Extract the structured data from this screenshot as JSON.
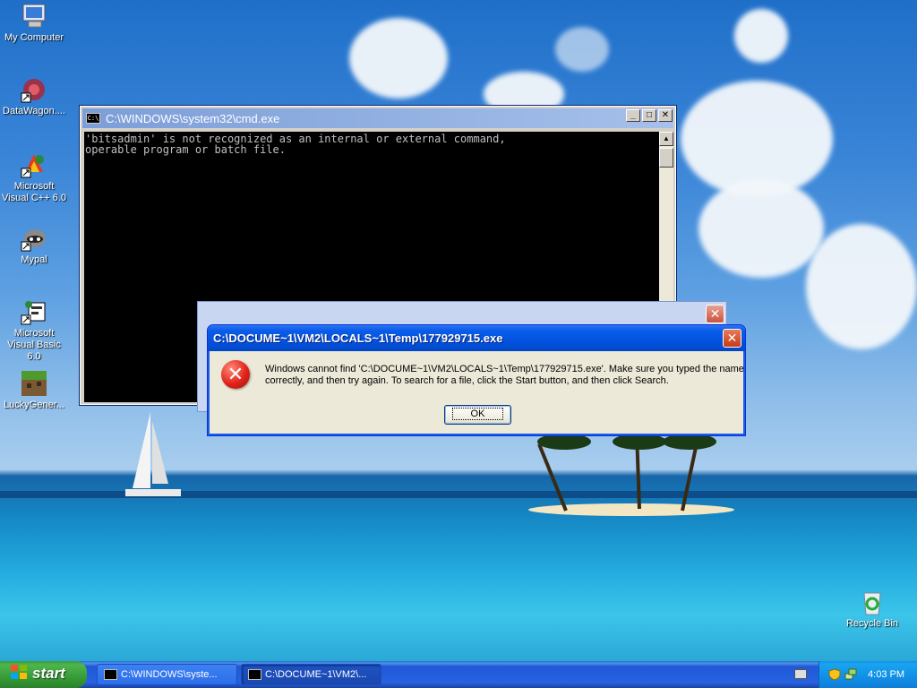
{
  "desktop": {
    "icons": [
      {
        "label": "My Computer"
      },
      {
        "label": "DataWagon...."
      },
      {
        "label": "Microsoft Visual C++ 6.0"
      },
      {
        "label": "Mypal"
      },
      {
        "label": "Microsoft Visual Basic 6.0"
      },
      {
        "label": "LuckyGener..."
      },
      {
        "label": "Recycle Bin"
      }
    ]
  },
  "cmd_window": {
    "title": "C:\\WINDOWS\\system32\\cmd.exe",
    "icon_text": "C:\\",
    "output_line1": "'bitsadmin' is not recognized as an internal or external command,",
    "output_line2": "operable program or batch file."
  },
  "error_dialog": {
    "title": "C:\\DOCUME~1\\VM2\\LOCALS~1\\Temp\\177929715.exe",
    "message": "Windows cannot find 'C:\\DOCUME~1\\VM2\\LOCALS~1\\Temp\\177929715.exe'. Make sure you typed the name correctly, and then try again. To search for a file, click the Start button, and then click Search.",
    "ok_label": "OK"
  },
  "taskbar": {
    "start_label": "start",
    "tasks": [
      {
        "label": "C:\\WINDOWS\\syste..."
      },
      {
        "label": "C:\\DOCUME~1\\VM2\\..."
      }
    ],
    "clock": "4:03 PM"
  },
  "colors": {
    "titlebar_active": "#0352e0",
    "titlebar_inactive": "#7c9ed8",
    "start_green": "#379b37",
    "taskbar_blue": "#2663e0"
  }
}
